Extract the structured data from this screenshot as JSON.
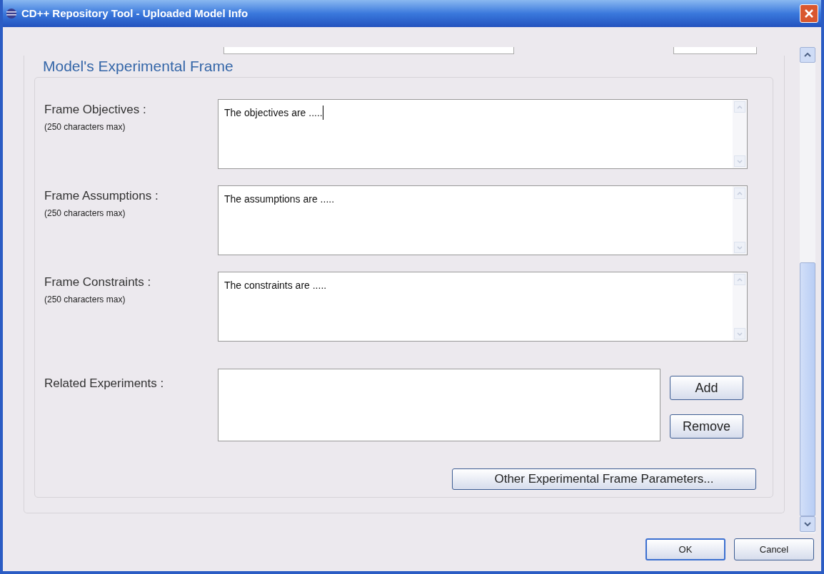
{
  "window": {
    "title": "CD++ Repository Tool - Uploaded Model Info"
  },
  "group": {
    "title": "Model's Experimental Frame"
  },
  "fields": [
    {
      "label": "Frame Objectives :",
      "hint": "(250 characters max)",
      "value": "The objectives are .....",
      "focused": true
    },
    {
      "label": "Frame Assumptions :",
      "hint": "(250 characters max)",
      "value": "The assumptions are .....",
      "focused": false
    },
    {
      "label": "Frame Constraints :",
      "hint": "(250 characters max)",
      "value": "The constraints are .....",
      "focused": false
    }
  ],
  "related": {
    "label": "Related Experiments :",
    "buttons": [
      "Add",
      "Remove"
    ]
  },
  "other_button": "Other Experimental Frame Parameters...",
  "buttons": [
    {
      "label": "OK",
      "default": true
    },
    {
      "label": "Cancel",
      "default": false
    }
  ]
}
